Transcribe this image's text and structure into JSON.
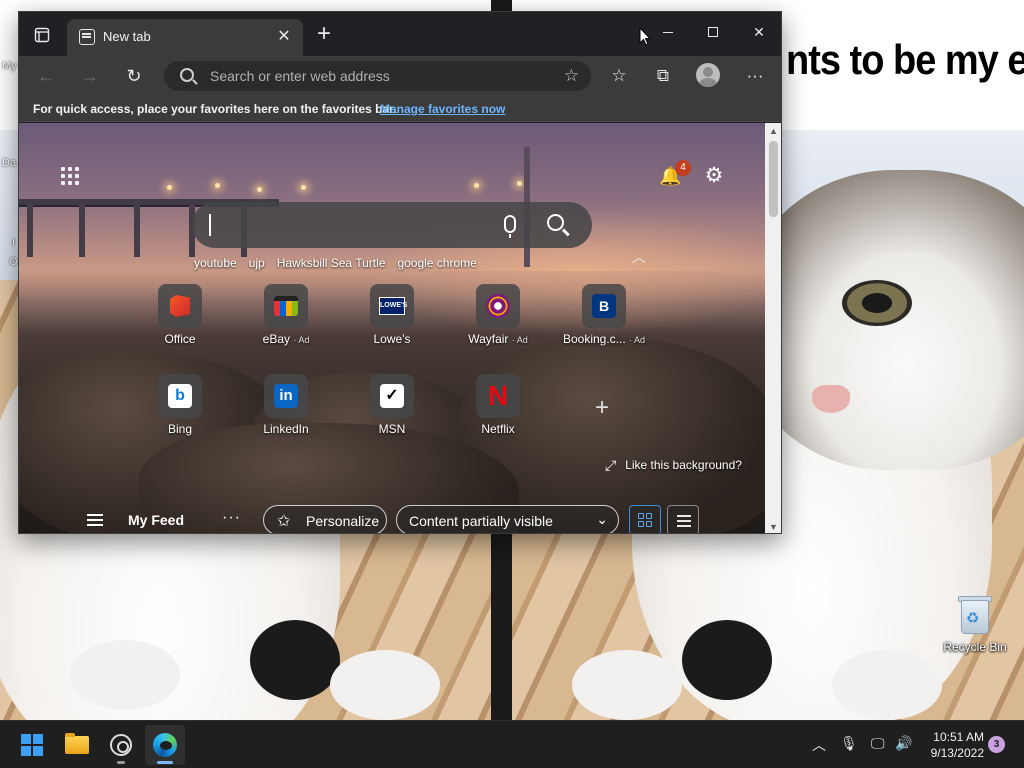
{
  "desktop": {
    "background_heading": "nts to be my ene",
    "fragments": [
      "My",
      "Da",
      "I",
      "O"
    ],
    "recycle_bin_label": "Recycle Bin"
  },
  "browser": {
    "tab": {
      "title": "New tab",
      "close_glyph": "✕"
    },
    "new_tab_glyph": "+",
    "window_controls": {
      "minimize": "—",
      "maximize": "☐",
      "close": "✕"
    },
    "toolbar": {
      "back_glyph": "←",
      "forward_glyph": "→",
      "refresh_glyph": "↻",
      "address_placeholder": "Search or enter web address",
      "favorite_glyph": "☆",
      "favorites_glyph": "☆",
      "collections_glyph": "⧉",
      "more_glyph": "···"
    },
    "favorites_bar": {
      "message": "For quick access, place your favorites here on the favorites bar.",
      "link": "Manage favorites now"
    }
  },
  "new_tab_page": {
    "notification_count": "4",
    "bell_glyph": "🔔",
    "settings_glyph": "⚙",
    "suggestions": [
      "youtube",
      "ujp",
      "Hawksbill Sea Turtle",
      "google chrome"
    ],
    "collapse_glyph": "︿",
    "quick_links": [
      {
        "label": "Office",
        "ad": "",
        "icon": "office-icon"
      },
      {
        "label": "eBay",
        "ad": "· Ad",
        "icon": "ebay-icon",
        "glyph": ""
      },
      {
        "label": "Lowe's",
        "ad": "",
        "icon": "lowes-icon",
        "glyph": "LOWE'S"
      },
      {
        "label": "Wayfair",
        "ad": "· Ad",
        "icon": "wayfair-icon"
      },
      {
        "label": "Booking.c...",
        "ad": "· Ad",
        "icon": "booking-icon",
        "glyph": "B"
      },
      {
        "label": "Bing",
        "ad": "",
        "icon": "bing-icon",
        "glyph": "b"
      },
      {
        "label": "LinkedIn",
        "ad": "",
        "icon": "linkedin-icon",
        "glyph": "in"
      },
      {
        "label": "MSN",
        "ad": "",
        "icon": "msn-icon",
        "glyph": "✓"
      },
      {
        "label": "Netflix",
        "ad": "",
        "icon": "netflix-icon",
        "glyph": "N"
      }
    ],
    "add_glyph": "+",
    "like_background": "Like this background?",
    "expand_glyph": "⤢",
    "feed": {
      "title": "My Feed",
      "more_glyph": "···",
      "personalize": "Personalize",
      "personalize_glyph": "✩",
      "content_select": "Content partially visible",
      "chevron_glyph": "⌄"
    }
  },
  "taskbar": {
    "apps": [
      "start",
      "file-explorer",
      "obs",
      "edge"
    ],
    "tray_glyphs": {
      "chevron": "︿",
      "mic": "🎙",
      "network": "🖵",
      "volume": "🔊"
    },
    "time": "10:51 AM",
    "date": "9/13/2022",
    "notification_count": "3"
  }
}
